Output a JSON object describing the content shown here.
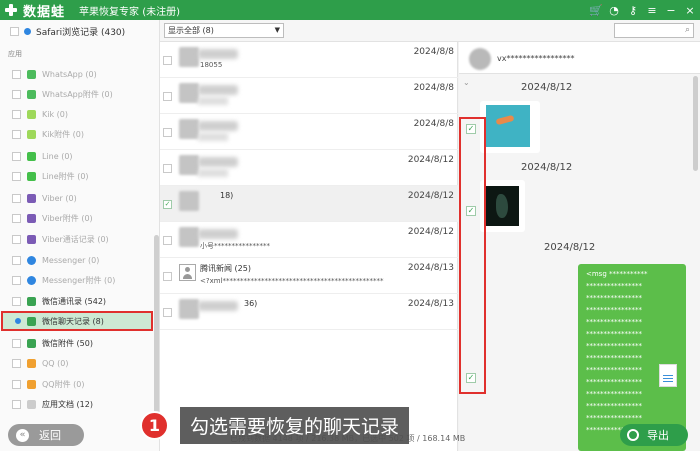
{
  "titlebar": {
    "brand": "数据蛙",
    "title": "苹果恢复专家 (未注册)",
    "icons": [
      "cart-icon",
      "wechat-icon",
      "key-icon",
      "menu-icon",
      "minimize-icon",
      "close-icon"
    ]
  },
  "sidebar": {
    "top_item": "Safari浏览记录 (430)",
    "section_label": "应用",
    "items": [
      {
        "label": "WhatsApp (0)",
        "color": "#4cbb5c",
        "dim": true
      },
      {
        "label": "WhatsApp附件 (0)",
        "color": "#4cbb5c",
        "dim": true
      },
      {
        "label": "Kik (0)",
        "color": "#9ed85a",
        "dim": true
      },
      {
        "label": "Kik附件 (0)",
        "color": "#9ed85a",
        "dim": true
      },
      {
        "label": "Line (0)",
        "color": "#44bf4a",
        "dim": true
      },
      {
        "label": "Line附件 (0)",
        "color": "#44bf4a",
        "dim": true
      },
      {
        "label": "Viber (0)",
        "color": "#7b5bb5",
        "dim": true
      },
      {
        "label": "Viber附件 (0)",
        "color": "#7b5bb5",
        "dim": true
      },
      {
        "label": "Viber通话记录 (0)",
        "color": "#7b5bb5",
        "dim": true
      },
      {
        "label": "Messenger (0)",
        "color": "#2f86e0",
        "dim": true
      },
      {
        "label": "Messenger附件 (0)",
        "color": "#2f86e0",
        "dim": true
      },
      {
        "label": "微信通讯录 (542)",
        "color": "#3aa352",
        "dim": false
      },
      {
        "label": "微信聊天记录 (8)",
        "color": "#3aa352",
        "dim": false,
        "active": true
      },
      {
        "label": "微信附件 (50)",
        "color": "#3aa352",
        "dim": false
      },
      {
        "label": "QQ (0)",
        "color": "#f0a030",
        "dim": true
      },
      {
        "label": "QQ附件 (0)",
        "color": "#f0a030",
        "dim": true
      },
      {
        "label": "应用文档 (12)",
        "color": "#cccccc",
        "dim": false
      }
    ],
    "back_label": "返回"
  },
  "toolbar": {
    "filter_value": "显示全部 (8)",
    "search_placeholder": ""
  },
  "list": {
    "rows": [
      {
        "sub": "18055",
        "date": "2024/8/8"
      },
      {
        "sub": "",
        "date": "2024/8/8"
      },
      {
        "sub": "",
        "date": "2024/8/8"
      },
      {
        "sub": "",
        "date": "2024/8/12"
      },
      {
        "title": "18)",
        "date": "2024/8/12",
        "checked": true,
        "selected": true
      },
      {
        "sub": "小号****************",
        "date": "2024/8/12"
      },
      {
        "title": "腾讯新闻 (25)",
        "sub": "<?xml**********************************************",
        "date": "2024/8/13",
        "person": true
      },
      {
        "title": "36)",
        "date": "2024/8/13"
      }
    ]
  },
  "chat": {
    "contact": "vx*****************",
    "dates": [
      "2024/8/12",
      "2024/8/12",
      "2024/8/12"
    ],
    "msg_lines": [
      "<msg ***********",
      "****************",
      "****************",
      "****************",
      "****************",
      "****************",
      "****************",
      "****************",
      "****************",
      "****************",
      "****************",
      "****************",
      "****************",
      "****************"
    ]
  },
  "status": {
    "text": "已找到数据 4148 项 / 216.38 MB，已选中 502 项 / 168.14 MB"
  },
  "export_label": "导出",
  "caption": {
    "step": "1",
    "text": "勾选需要恢复的聊天记录"
  },
  "colors": {
    "brand_green": "#2e9e4a",
    "highlight_red": "#e0302d",
    "bubble_green": "#5cbe4a"
  }
}
